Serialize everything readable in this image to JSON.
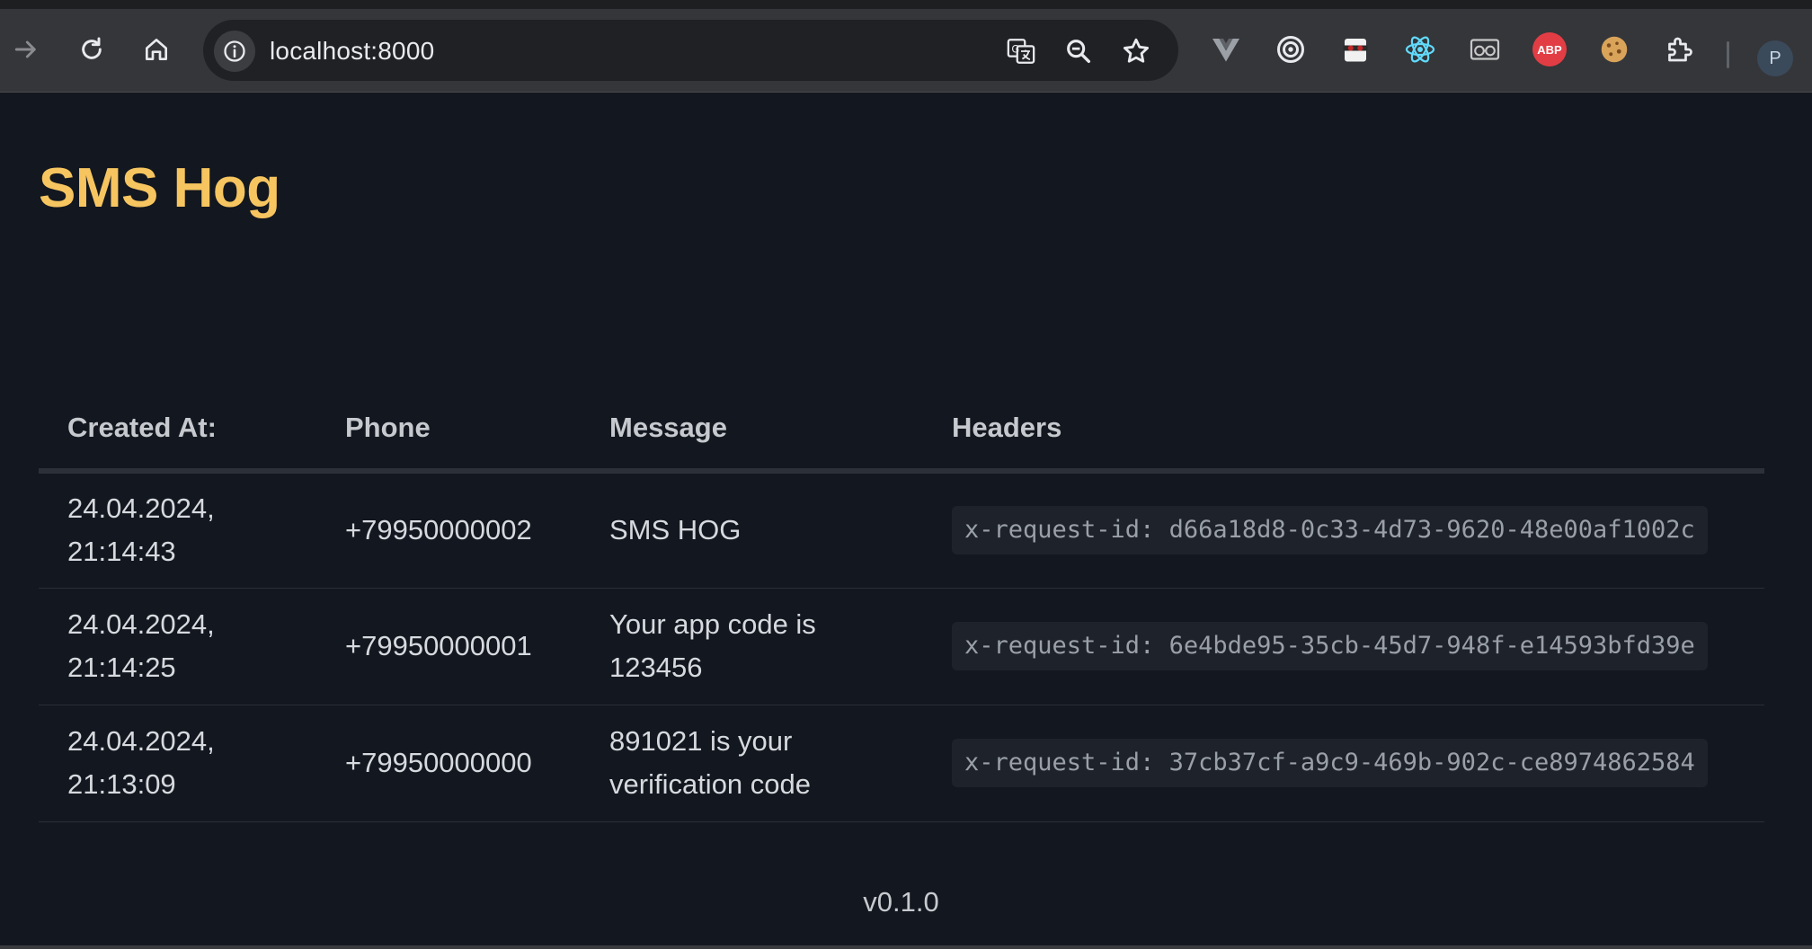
{
  "browser": {
    "url": "localhost:8000",
    "profile_initial": "P",
    "abp_label": "ABP"
  },
  "app": {
    "title": "SMS Hog",
    "version": "v0.1.0"
  },
  "table": {
    "headers": [
      "Created At:",
      "Phone",
      "Message",
      "Headers"
    ],
    "rows": [
      {
        "date": "24.04.2024,",
        "time": "21:14:43",
        "phone": "+79950000002",
        "message": "SMS HOG",
        "headers": "x-request-id: d66a18d8-0c33-4d73-9620-48e00af1002c"
      },
      {
        "date": "24.04.2024,",
        "time": "21:14:25",
        "phone": "+79950000001",
        "message": "Your app code is 123456",
        "headers": "x-request-id: 6e4bde95-35cb-45d7-948f-e14593bfd39e"
      },
      {
        "date": "24.04.2024,",
        "time": "21:13:09",
        "phone": "+79950000000",
        "message": "891021 is your verification code",
        "headers": "x-request-id: 37cb37cf-a9c9-469b-902c-ce8974862584"
      }
    ]
  },
  "colors": {
    "title": "#f6c560",
    "background": "#13171f",
    "toolbar": "#35363a"
  }
}
